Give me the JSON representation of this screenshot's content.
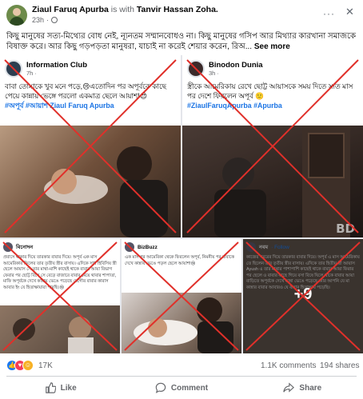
{
  "post": {
    "author": "Ziaul Faruq Apurba",
    "with_text": "is with",
    "tagged": "Tanvir Hassan Zoha.",
    "time": "23h",
    "time_sep": "·",
    "more_label": "···",
    "close_label": "✕",
    "caption": "কিছু মানুষের সত্য-মিথ্যের বোধ নেই, ন্যূনতম সম্মানবোধও না। কিছু মানুষের গসিপ আর মিথ্যার কারখানা সমাজকে বিষাক্ত করে। আর কিছু গড়পড়তা মানুষরা, যাচাই না করেই শেয়ার করেন, রিঅ...",
    "see_more": "See more"
  },
  "grid": {
    "top_left": {
      "page": "Information Club",
      "time": "7h · ",
      "text": "বাবা তোমাকে খুব মনে পড়ে,😢এতোদিন পর অপূর্বকে কাছে পেয়ে কান্নায় ভেঙ্গে পরলো একমাত্র ছেলে আয়াশ!😍",
      "tag": "#অপূর্ব #আয়াশ Ziaul Faruq Apurba"
    },
    "top_right": {
      "page": "Binodon Dunia",
      "time": "3h · ",
      "text": "স্ত্রীকে আমেরিকায় রেখে ছোট্ট আয়াসকে সময় দিতে সাত মাস পর দেশে ফিরলেন অপূর্ব 🙂",
      "tag": "#ZiaulFaruqApurba #Apurba",
      "watermark": "BD"
    },
    "bottom_left": {
      "page": "বিনোদন",
      "text": "প্রবাসে থাকার দিয়ে তারকার বাবার দিয়ে। অপূর্ব এক মাস আমেরিকার ফিলের তার তৃতীয় স্ত্রীর বাসায়। এদিকে সাধ হিবিসিয় স্ত্রী ছেলে আয়াস সে তার মাথা-মাশি কাছেই থাকে বাবার আয়া বিভাগ ফেরার পর ছোট্ট বিখে সে বেড়ে বাজারে বাবার মেয়ে থাবার শাপাতা, মাফি অপূর্বকে দেখে কান্নায় ভেঙে পড়েছে যেগৌর বাবার কারাস আবার ইং যে হিতাক্ষায়ারা পারছি।😢"
    },
    "bottom_middle": {
      "page": "BizBuzz",
      "text": "এক মাস পর আমেরিকা থেকে ফিরলেন অপূর্ব, নিমনীয় পর বাবাকে দেখে কান্নায় ভেঙে পড়ল ছেলে আয়াশ!😢"
    },
    "bottom_right": {
      "page": "নবম",
      "follow": "· Follow",
      "text": "কাজের খবরের দিয়ে তারকার বাবার দিয়ে। অপূর্ব এ মাস আমেরিকায় তে ছিলেন তার তৃতীয় স্ত্রীর বাসায়। এদিকে তার হিতীয় স্ত্রী আয়াস Ayush এ তার মাথার পাশাপাশি কাছেই থাকে বাবার আয়া ফিরার পর ছেলে ও বাবার কাছে গিয়ে বসা বিষে ঘিলে থাকে বাবার আয়া বাড়িতে অপূর্বকে দেখে কান্না ভেঙে পড়েছে আর আপনি যে মা কান্নার বাবার আবারও যে বাবার হিতাক্ষায় পড়েছি।",
      "more_count": "+9"
    }
  },
  "stats": {
    "reactions_count": "17K",
    "comments": "1.1K comments",
    "shares": "194 shares"
  },
  "actions": {
    "like": "Like",
    "comment": "Comment",
    "share": "Share"
  },
  "colors": {
    "accent": "#1877f2",
    "x_mark": "#e0302a"
  }
}
